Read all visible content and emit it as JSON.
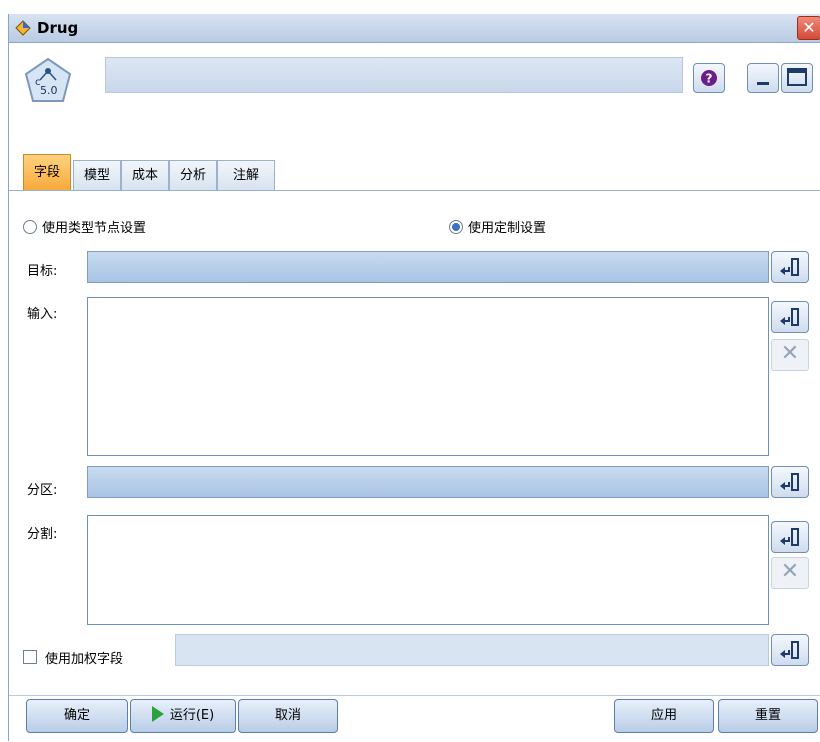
{
  "window": {
    "title": "Drug",
    "close_label": "✕"
  },
  "header": {
    "node_label": "5.0",
    "node_letter": "c"
  },
  "tabs": [
    {
      "label": "字段",
      "active": true
    },
    {
      "label": "模型",
      "active": false
    },
    {
      "label": "成本",
      "active": false
    },
    {
      "label": "分析",
      "active": false
    },
    {
      "label": "注解",
      "active": false
    }
  ],
  "settings": {
    "use_type_node": "使用类型节点设置",
    "use_custom": "使用定制设置",
    "selected": "使用定制设置"
  },
  "fields": {
    "target_label": "目标:",
    "inputs_label": "输入:",
    "partition_label": "分区:",
    "split_label": "分割:",
    "weight_label": "使用加权字段"
  },
  "footer": {
    "ok": "确定",
    "run": "运行(E)",
    "cancel": "取消",
    "apply": "应用",
    "reset": "重置"
  },
  "colors": {
    "accent_tab": "#f7a93a",
    "field_blue": "#a9c4e4",
    "run_green": "#2ea13c"
  }
}
